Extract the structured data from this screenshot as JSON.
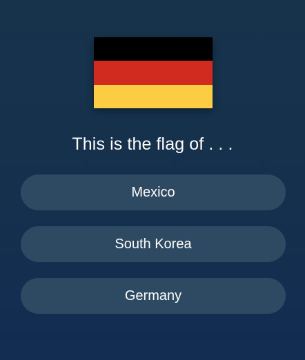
{
  "flag": {
    "name": "germany-flag",
    "stripes": [
      "#000000",
      "#d12b1f",
      "#fccd43"
    ]
  },
  "question": "This is the flag of . . .",
  "options": [
    {
      "label": "Mexico"
    },
    {
      "label": "South Korea"
    },
    {
      "label": "Germany"
    }
  ],
  "colors": {
    "background": "#15304d",
    "option_background": "#2e4a63",
    "text": "#ffffff"
  }
}
